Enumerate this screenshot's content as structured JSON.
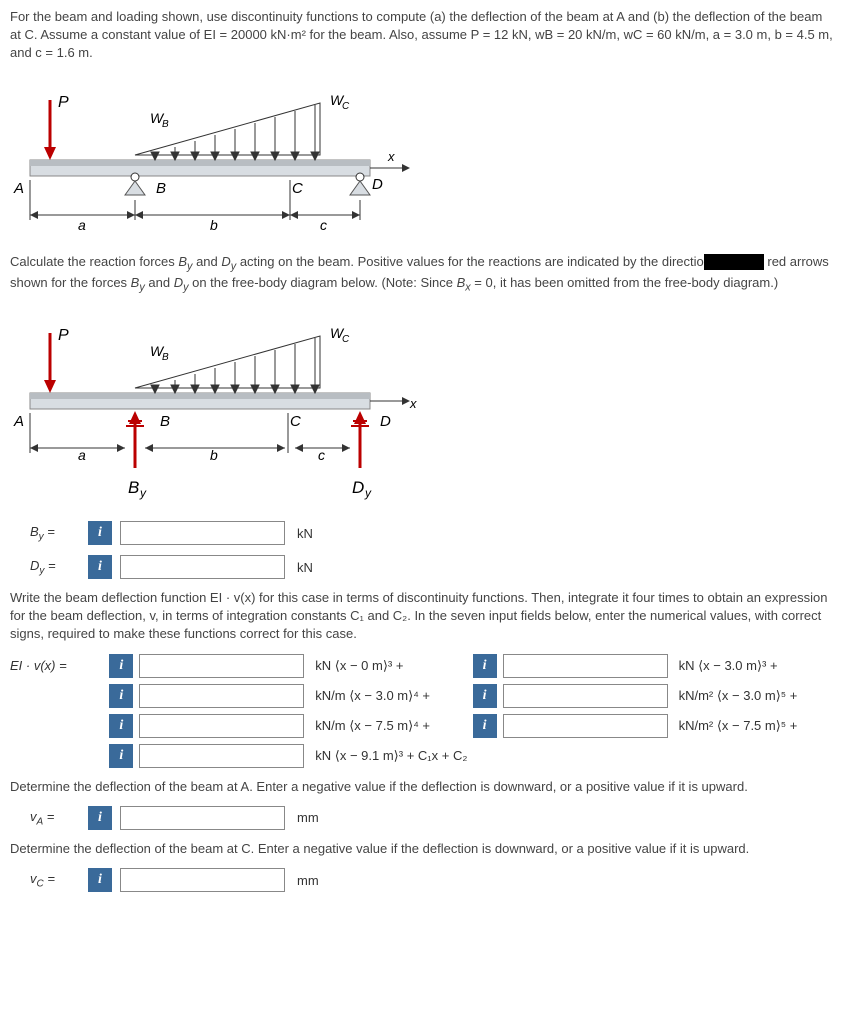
{
  "problem": {
    "intro": "For the beam and loading shown, use discontinuity functions to compute (a) the deflection of the beam at A and (b) the deflection of the beam at C. Assume a constant value of EI = 20000 kN·m² for the beam. Also, assume P = 12 kN, wB = 20 kN/m, wC = 60 kN/m, a = 3.0 m, b = 4.5 m, and c = 1.6 m."
  },
  "fig1": {
    "P": "P",
    "WB": "WB",
    "WC": "WC",
    "A": "A",
    "B": "B",
    "C": "C",
    "D": "D",
    "x": "x",
    "a": "a",
    "b": "b",
    "c": "c"
  },
  "reactions": {
    "text": "Calculate the reaction forces By and Dy acting on the beam. Positive values for the reactions are indicated by the directio       red arrows shown for the forces By and Dy on the free-body diagram below. (Note: Since Bx = 0, it has been omitted from the free-body diagram.)",
    "By_html": "B<sub>y</sub> =",
    "Dy_html": "D<sub>y</sub> =",
    "By_unit": "kN",
    "Dy_unit": "kN"
  },
  "fig2": {
    "P": "P",
    "WB": "WB",
    "WC": "WC",
    "A": "A",
    "B": "B",
    "C": "C",
    "D": "D",
    "x": "x",
    "a": "a",
    "b": "b",
    "c": "c",
    "By": "By",
    "Dy": "Dy"
  },
  "deflection": {
    "text": "Write the beam deflection function EI · v(x) for this case in terms of discontinuity functions. Then, integrate it four times to obtain an expression for the beam deflection, v, in terms of integration constants C₁ and C₂. In the seven input fields below, enter the numerical values, with correct signs, required to make these functions correct for this case.",
    "lhs": "EI · v(x) =",
    "t1": "kN ⟨x − 0 m⟩³ +",
    "t2": "kN ⟨x − 3.0 m⟩³ +",
    "t3": "kN/m ⟨x − 3.0 m⟩⁴ +",
    "t4": "kN/m² ⟨x − 3.0 m⟩⁵ +",
    "t5": "kN/m ⟨x − 7.5 m⟩⁴ +",
    "t6": "kN/m² ⟨x − 7.5 m⟩⁵ +",
    "t7": "kN ⟨x − 9.1 m⟩³ + C₁x + C₂"
  },
  "partA": {
    "text": "Determine the deflection of the beam at A. Enter a negative value if the deflection is downward, or a positive value if it is upward.",
    "label_html": "v<sub>A</sub> =",
    "unit": "mm"
  },
  "partC": {
    "text": "Determine the deflection of the beam at C. Enter a negative value if the deflection is downward, or a positive value if it is upward.",
    "label_html": "v<sub>C</sub> =",
    "unit": "mm"
  }
}
